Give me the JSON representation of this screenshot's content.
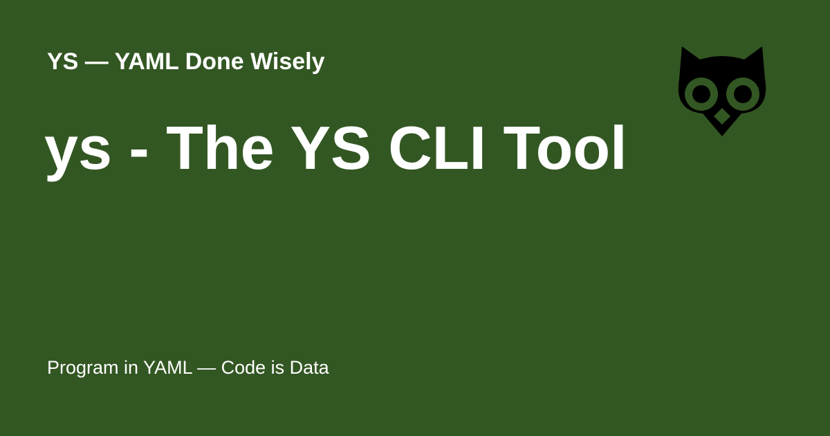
{
  "card": {
    "site_name": "YS — YAML Done Wisely",
    "title": "ys - The YS CLI Tool",
    "tagline": "Program in YAML — Code is Data",
    "logo_icon": "owl-icon",
    "colors": {
      "background": "#335723",
      "text": "#ffffff",
      "logo": "#000000"
    }
  }
}
